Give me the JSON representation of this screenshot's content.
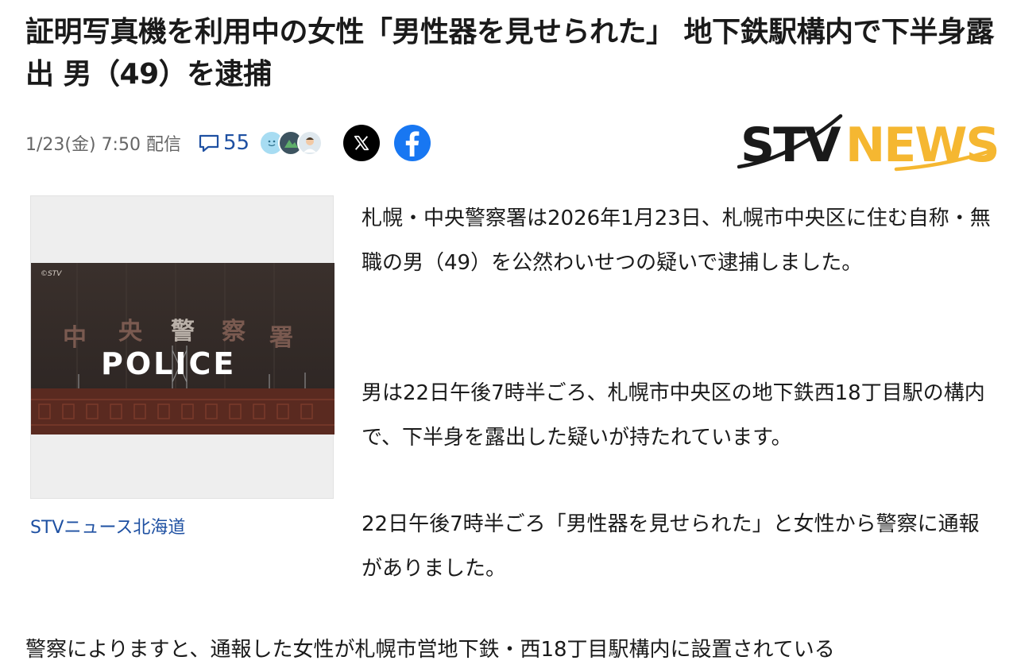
{
  "article": {
    "title": "証明写真機を利用中の女性「男性器を見せられた」 地下鉄駅構内で下半身露出 男（49）を逮捕",
    "date": "1/23(金) 7:50 配信",
    "comment_count": "55",
    "source_logo": {
      "part1": "STV",
      "part2": "NEWS"
    },
    "image": {
      "watermark": "©STV",
      "sign_text": "POLICE",
      "building_chars": [
        "中",
        "央",
        "警",
        "察",
        "署"
      ]
    },
    "caption": "STVニュース北海道",
    "paragraphs": [
      "札幌・中央警察署は2026年1月23日、札幌市中央区に住む自称・無職の男（49）を公然わいせつの疑いで逮捕しました。",
      "男は22日午後7時半ごろ、札幌市中央区の地下鉄西18丁目駅の構内で、下半身を露出した疑いが持たれています。",
      "22日午後7時半ごろ「男性器を見せられた」と女性から警察に通報がありました。",
      "警察によりますと、通報した女性が札幌市営地下鉄・西18丁目駅構内に設置されている"
    ]
  },
  "icons": [
    "comment-icon",
    "x-icon",
    "facebook-icon"
  ],
  "colors": {
    "link": "#1e50a2",
    "logo_yellow": "#f5b731",
    "facebook": "#1877f2"
  }
}
